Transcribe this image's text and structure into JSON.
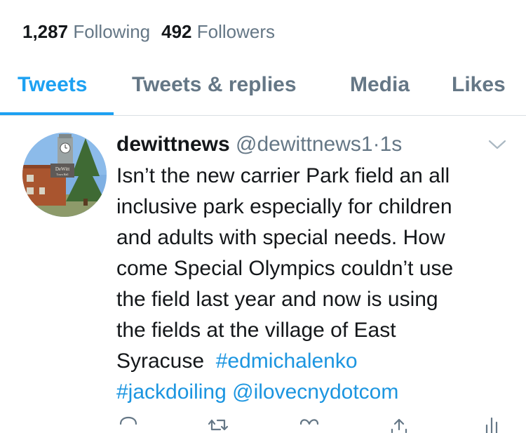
{
  "profile_stats": {
    "following_count": "1,287",
    "following_label": "Following",
    "followers_count": "492",
    "followers_label": "Followers"
  },
  "tabs": [
    {
      "label": "Tweets",
      "active": true
    },
    {
      "label": "Tweets & replies",
      "active": false
    },
    {
      "label": "Media",
      "active": false
    },
    {
      "label": "Likes",
      "active": false
    }
  ],
  "tweet": {
    "display_name": "dewittnews",
    "handle": "@dewittnews1",
    "separator": "·",
    "timestamp": "1s",
    "text_lines": [
      "Isn’t the new carrier Park field an all",
      "inclusive park especially for children",
      "and adults with special needs. How",
      "come Special Olympics couldn’t use",
      "the field last year and now is using",
      "the fields at the village of East",
      "Syracuse"
    ],
    "hashtag_1": "#edmichalenko",
    "hashtag_2": "#jackdoiling",
    "mention": "@ilovecnydotcom",
    "avatar_sign_text": "DeWitt",
    "avatar_sign_subtext": "Town Hall"
  },
  "actions": [
    {
      "icon": "reply-icon"
    },
    {
      "icon": "retweet-icon"
    },
    {
      "icon": "like-icon"
    },
    {
      "icon": "share-icon"
    },
    {
      "icon": "analytics-icon"
    }
  ],
  "colors": {
    "accent": "#1da1f2",
    "link": "#1b95e0",
    "secondary_text": "#657786",
    "primary_text": "#14171a",
    "divider": "#d9dfe3"
  }
}
